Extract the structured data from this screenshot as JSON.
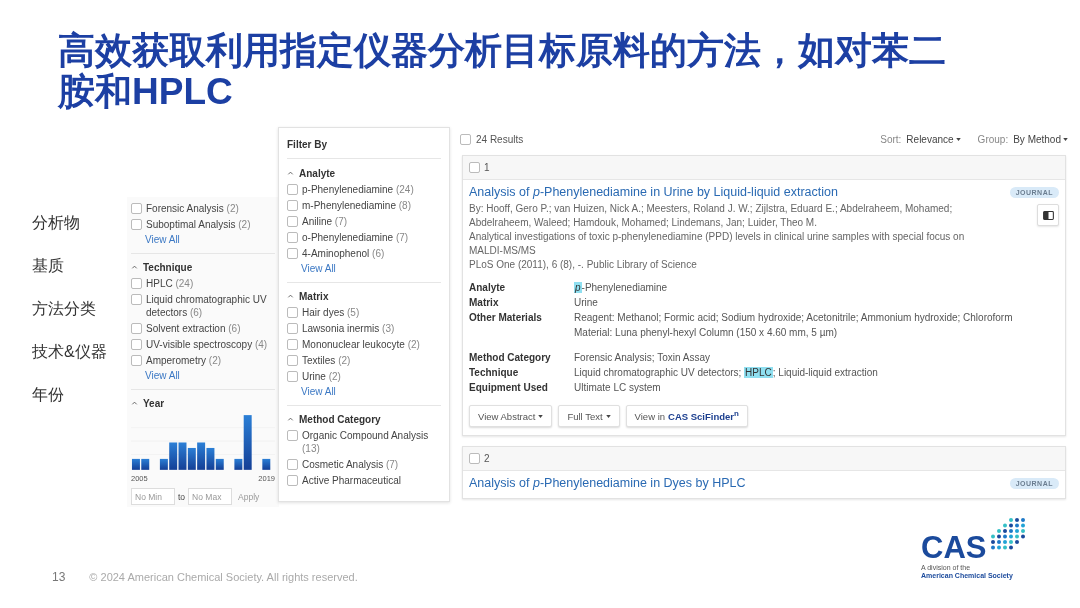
{
  "slide": {
    "title": "高效获取利用指定仪器分析目标原料的方法，如对苯二胺和HPLC",
    "page_number": "13",
    "copyright": "© 2024 American Chemical Society. All rights reserved.",
    "logo": {
      "name": "CAS",
      "line_1": "A division of the",
      "line_2": "American Chemical Society"
    }
  },
  "side_labels": [
    "分析物",
    "基质",
    "方法分类",
    "技术&仪器",
    "年份"
  ],
  "filter_left": {
    "sections": [
      {
        "kind": "list",
        "options": [
          {
            "label": "Forensic Analysis",
            "count": "(2)",
            "checked": false
          },
          {
            "label": "Suboptimal Analysis",
            "count": "(2)",
            "checked": false
          }
        ],
        "view_all": "View All"
      },
      {
        "kind": "list",
        "heading": "Technique",
        "expanded": true,
        "options": [
          {
            "label": "HPLC",
            "count": "(24)",
            "checked": false
          },
          {
            "label": "Liquid chromatographic UV detectors",
            "count": "(6)",
            "checked": false
          },
          {
            "label": "Solvent extraction",
            "count": "(6)",
            "checked": false
          },
          {
            "label": "UV-visible spectroscopy",
            "count": "(4)",
            "checked": false
          },
          {
            "label": "Amperometry",
            "count": "(2)",
            "checked": false
          }
        ],
        "view_all": "View All"
      },
      {
        "kind": "year",
        "heading": "Year",
        "expanded": true,
        "axis_start": "2005",
        "axis_end": "2019",
        "min_placeholder": "No Min",
        "separator": "to",
        "max_placeholder": "No Max",
        "apply": {
          "label": "Apply",
          "disabled": true
        }
      }
    ]
  },
  "filter_panel": {
    "title": "Filter By",
    "sections": [
      {
        "kind": "list",
        "heading": "Analyte",
        "expanded": true,
        "options": [
          {
            "label": "p-Phenylenediamine",
            "count": "(24)",
            "checked": false
          },
          {
            "label": "m-Phenylenediamine",
            "count": "(8)",
            "checked": false
          },
          {
            "label": "Aniline",
            "count": "(7)",
            "checked": false
          },
          {
            "label": "o-Phenylenediamine",
            "count": "(7)",
            "checked": false
          },
          {
            "label": "4-Aminophenol",
            "count": "(6)",
            "checked": false
          }
        ],
        "view_all": "View All"
      },
      {
        "kind": "list",
        "heading": "Matrix",
        "expanded": true,
        "options": [
          {
            "label": "Hair dyes",
            "count": "(5)",
            "checked": false
          },
          {
            "label": "Lawsonia inermis",
            "count": "(3)",
            "checked": false
          },
          {
            "label": "Mononuclear leukocyte",
            "count": "(2)",
            "checked": false
          },
          {
            "label": "Textiles",
            "count": "(2)",
            "checked": false
          },
          {
            "label": "Urine",
            "count": "(2)",
            "checked": false
          }
        ],
        "view_all": "View All"
      },
      {
        "kind": "list",
        "heading": "Method Category",
        "expanded": true,
        "options": [
          {
            "label": "Organic Compound Analysis",
            "count": "(13)",
            "checked": false
          },
          {
            "label": "Cosmetic Analysis",
            "count": "(7)",
            "checked": false
          },
          {
            "label": "Active Pharmaceutical",
            "checked": false
          }
        ]
      }
    ]
  },
  "results": {
    "count_label": "24 Results",
    "select_all_checked": false,
    "sort": {
      "label": "Sort:",
      "value": "Relevance"
    },
    "group": {
      "label": "Group:",
      "value": "By Method"
    },
    "items": [
      {
        "number": "1",
        "checked": false,
        "title": "Analysis of *p*-Phenylenediamine in Urine by Liquid-liquid extraction",
        "badge": "JOURNAL",
        "authors": "By: Hooff, Gero P.; van Huizen, Nick A.; Meesters, Roland J. W.; Zijlstra, Eduard E.; Abdelraheem, Mohamed; Abdelraheem, Waleed; Hamdouk, Mohamed; Lindemans, Jan; Luider, Theo M.",
        "abstract": "Analytical investigations of toxic p-phenylenediamine (PPD) levels in clinical urine samples with special focus on MALDI-MS/MS",
        "source": "PLoS One (2011), 6 (8), -. Public Library of Science",
        "fields": [
          {
            "label": "Analyte",
            "segments": [
              {
                "text": "*p*",
                "highlight": true
              },
              {
                "text": "-Phenylenediamine",
                "highlight": false
              }
            ]
          },
          {
            "label": "Matrix",
            "segments": [
              {
                "text": "Urine",
                "highlight": false
              }
            ]
          },
          {
            "label": "Other Materials",
            "segments": [
              {
                "text": "Reagent: Methanol; Formic acid; Sodium hydroxide; Acetonitrile; Ammonium hydroxide; Chloroform Material: Luna phenyl-hexyl Column (150 x 4.60 mm, 5 µm)",
                "highlight": false
              }
            ]
          },
          {
            "label": "Method Category",
            "segments": [
              {
                "text": "Forensic Analysis; Toxin Assay",
                "highlight": false
              }
            ]
          },
          {
            "label": "Technique",
            "segments": [
              {
                "text": "Liquid chromatographic UV detectors; ",
                "highlight": false
              },
              {
                "text": "HPLC",
                "highlight": true
              },
              {
                "text": "; Liquid-liquid extraction",
                "highlight": false
              }
            ]
          },
          {
            "label": "Equipment Used",
            "segments": [
              {
                "text": "Ultimate LC system",
                "highlight": false
              }
            ]
          }
        ],
        "buttons": [
          {
            "kind": "dropdown",
            "label": "View Abstract"
          },
          {
            "kind": "dropdown",
            "label": "Full Text"
          },
          {
            "kind": "brand",
            "label": "View in",
            "brand": "CAS SciFinder$^{n}$"
          }
        ]
      },
      {
        "number": "2",
        "checked": false,
        "title": "Analysis of *p*-Phenylenediamine in Dyes by HPLC",
        "badge": "JOURNAL"
      }
    ]
  }
}
